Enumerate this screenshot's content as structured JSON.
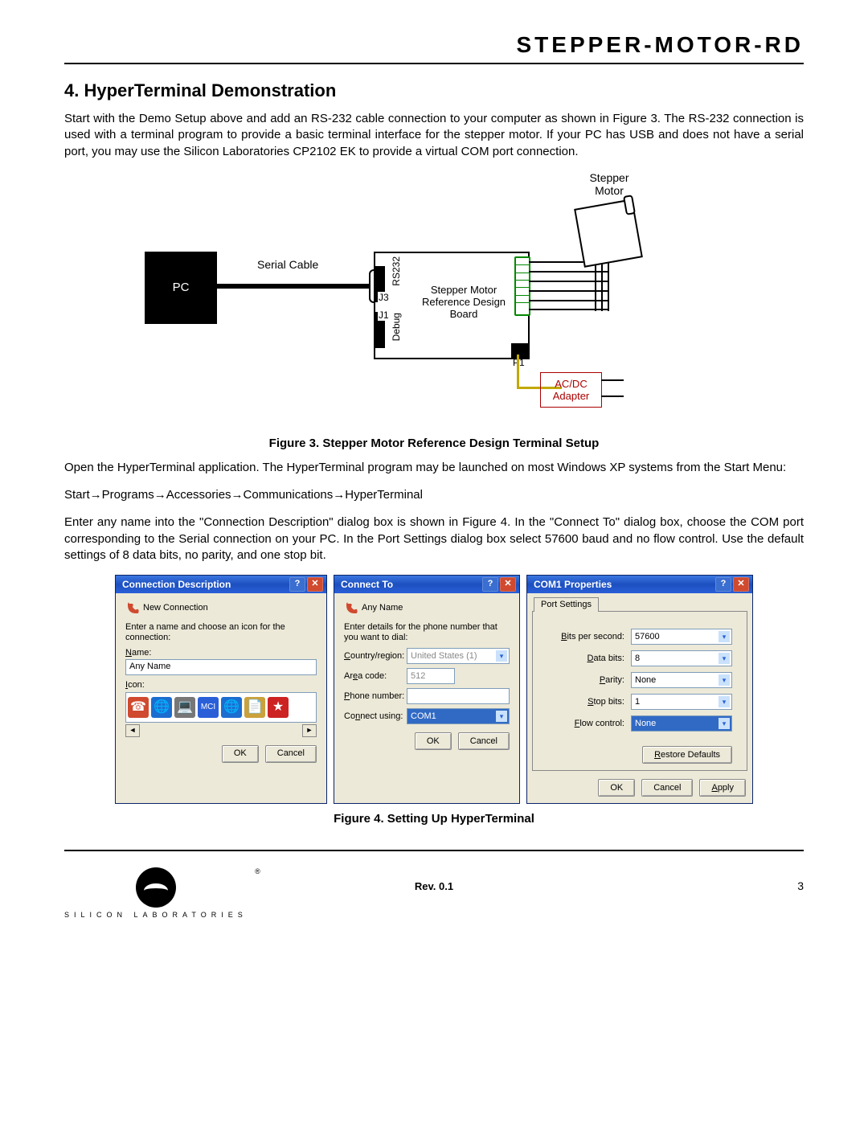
{
  "header": {
    "doc_title": "STEPPER-MOTOR-RD"
  },
  "section": {
    "number": "4.",
    "title": "HyperTerminal Demonstration",
    "p1": "Start with the Demo Setup above and add an RS-232 cable connection to your computer as shown in Figure 3. The RS-232 connection is used with a terminal program to provide a basic terminal interface for the stepper motor. If your PC has USB and does not have a serial port, you may use the Silicon Laboratories CP2102 EK to provide a virtual COM port connection.",
    "fig3_caption": "Figure 3. Stepper Motor Reference Design Terminal Setup",
    "p2": "Open the HyperTerminal application. The HyperTerminal program may be launched on most Windows XP systems from the Start Menu:",
    "path": "Start→Programs→Accessories→Communications→HyperTerminal",
    "p3": "Enter any name into the \"Connection Description\" dialog box is shown in Figure 4. In the \"Connect To\" dialog box, choose the COM port corresponding to the Serial connection on your PC. In the Port Settings dialog box select 57600 baud and no flow control. Use the default settings of 8 data bits, no parity, and one stop bit.",
    "fig4_caption": "Figure 4. Setting Up HyperTerminal"
  },
  "diagram": {
    "pc": "PC",
    "serial_cable": "Serial Cable",
    "rs232": "RS232",
    "j3": "J3",
    "j1": "J1",
    "debug": "Debug",
    "board_l1": "Stepper Motor",
    "board_l2": "Reference Design",
    "board_l3": "Board",
    "p1": "P1",
    "motor_l1": "Stepper",
    "motor_l2": "Motor",
    "acdc_l1": "AC/DC",
    "acdc_l2": "Adapter"
  },
  "dlg1": {
    "title": "Connection Description",
    "new_conn": "New Connection",
    "instr": "Enter a name and choose an icon for the connection:",
    "name_label": "Name:",
    "name_value": "Any Name",
    "icon_label": "Icon:",
    "ok": "OK",
    "cancel": "Cancel"
  },
  "dlg2": {
    "title": "Connect To",
    "any_name": "Any Name",
    "instr": "Enter details for the phone number that you want to dial:",
    "country_label": "Country/region:",
    "country_value": "United States (1)",
    "area_label": "Area code:",
    "area_value": "512",
    "phone_label": "Phone number:",
    "phone_value": "",
    "connect_label": "Connect using:",
    "connect_value": "COM1",
    "ok": "OK",
    "cancel": "Cancel"
  },
  "dlg3": {
    "title": "COM1 Properties",
    "tab": "Port Settings",
    "bps_label": "Bits per second:",
    "bps_value": "57600",
    "databits_label": "Data bits:",
    "databits_value": "8",
    "parity_label": "Parity:",
    "parity_value": "None",
    "stopbits_label": "Stop bits:",
    "stopbits_value": "1",
    "flow_label": "Flow control:",
    "flow_value": "None",
    "restore": "Restore Defaults",
    "ok": "OK",
    "cancel": "Cancel",
    "apply": "Apply"
  },
  "footer": {
    "brand": "SILICON LABORATORIES",
    "rev": "Rev. 0.1",
    "page": "3"
  }
}
